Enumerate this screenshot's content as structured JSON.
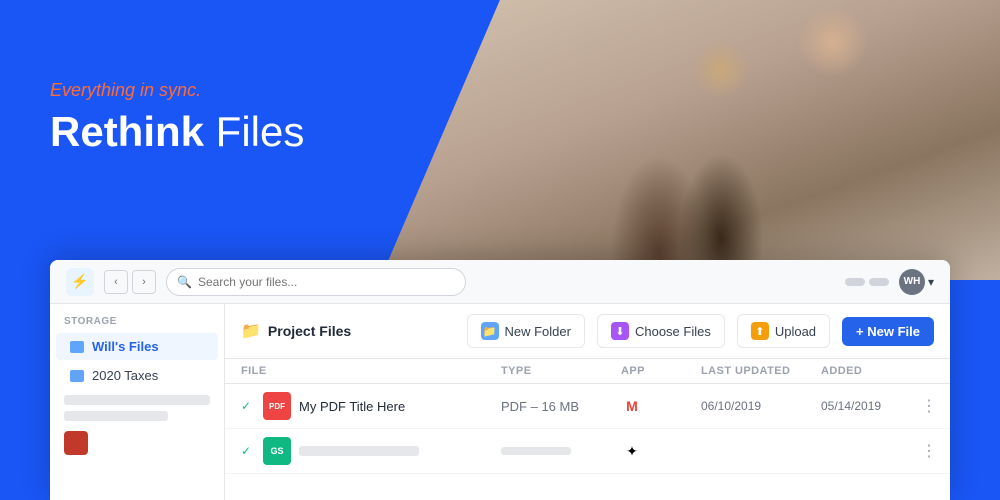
{
  "hero": {
    "tagline": "Everything in sync.",
    "headline_bold": "Rethink",
    "headline_rest": " Files"
  },
  "app": {
    "search_placeholder": "Search your files...",
    "user_initials": "WH",
    "user_chevron": "▾"
  },
  "sidebar": {
    "section_label": "Storage",
    "items": [
      {
        "label": "Will's Files",
        "active": true
      },
      {
        "label": "2020 Taxes",
        "active": false
      }
    ]
  },
  "toolbar": {
    "folder_name": "Project Files",
    "new_folder_label": "New Folder",
    "choose_files_label": "Choose Files",
    "upload_label": "Upload",
    "new_file_label": "+ New File"
  },
  "table": {
    "columns": [
      "File",
      "Type",
      "App",
      "Last Updated",
      "Added",
      ""
    ],
    "rows": [
      {
        "checked": true,
        "file_type": "PDF",
        "file_name": "My PDF Title Here",
        "type_text": "PDF – 16 MB",
        "app": "gmail",
        "last_updated": "06/10/2019",
        "added": "05/14/2019"
      },
      {
        "checked": true,
        "file_type": "SHEET",
        "file_name": "",
        "type_text": "",
        "app": "drive",
        "last_updated": "",
        "added": ""
      }
    ]
  },
  "icons": {
    "logo": "⚡",
    "back": "‹",
    "forward": "›",
    "search": "🔍",
    "folder": "📁",
    "new_folder": "+",
    "choose": "↓",
    "upload": "↑",
    "more": "⋮"
  }
}
